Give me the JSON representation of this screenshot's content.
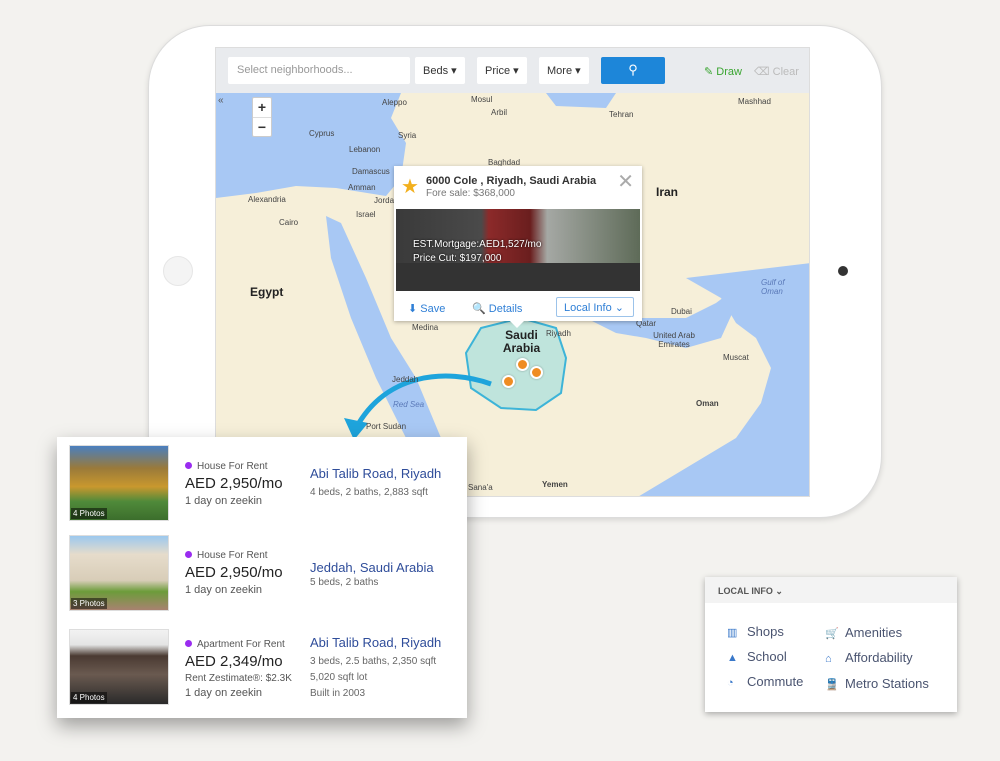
{
  "toolbar": {
    "search_placeholder": "Select neighborhoods...",
    "beds": "Beds ▾",
    "price": "Price ▾",
    "more": "More ▾",
    "search_icon": "search-icon",
    "draw": "Draw",
    "clear": "Clear"
  },
  "map": {
    "zoom_in": "+",
    "zoom_out": "−",
    "collapse": "«",
    "labels": [
      "Aleppo",
      "Mosul",
      "Arbil",
      "Mashhad",
      "Tehran",
      "Cyprus",
      "Syria",
      "Lebanon",
      "Damascus",
      "Baghdad",
      "Amman",
      "Jordan",
      "Israel",
      "Alexandria",
      "Cairo",
      "Egypt",
      "Iran",
      "Medina",
      "Riyadh",
      "Saudi Arabia",
      "Qatar",
      "Dubai",
      "United Arab Emirates",
      "Gulf of Oman",
      "Muscat",
      "Jeddah",
      "Red Sea",
      "Port Sudan",
      "Oman",
      "Sana'a",
      "Yemen"
    ],
    "colors": {
      "land": "#f6efd9",
      "water": "#a8c8f4",
      "area": "#5bc7d6",
      "pin": "#ef8c22"
    }
  },
  "popup": {
    "title": "6000 Cole , Riyadh, Saudi Arabia",
    "subtitle": "Fore sale: $368,000",
    "mortgage": "EST.Mortgage:AED1,527/mo",
    "price_cut": "Price Cut: $197,000",
    "save": "Save",
    "details": "Details",
    "local_info": "Local Info ⌄"
  },
  "listings": [
    {
      "photos": "4 Photos",
      "type": "House For Rent",
      "price": "AED 2,950/mo",
      "days": "1 day on zeekin",
      "address": "Abi Talib Road, Riyadh",
      "details": [
        "4 beds, 2 baths, 2,883 sqft"
      ]
    },
    {
      "photos": "3 Photos",
      "type": "House For Rent",
      "price": "AED 2,950/mo",
      "days": "1 day on zeekin",
      "address": "Jeddah, Saudi Arabia",
      "details": [
        "5 beds, 2 baths"
      ]
    },
    {
      "photos": "4 Photos",
      "type": "Apartment For Rent",
      "price": "AED 2,349/mo",
      "zestimate": "Rent Zestimate®: $2.3K",
      "days": "1 day on zeekin",
      "address": "Abi Talib Road, Riyadh",
      "details": [
        "3 beds, 2.5 baths, 2,350 sqft",
        "5,020 sqft lot",
        "Built in 2003"
      ]
    }
  ],
  "local_info": {
    "title": "LOCAL INFO ⌄",
    "items": [
      {
        "label": "Shops",
        "icon": "shop-icon"
      },
      {
        "label": "School",
        "icon": "graduation-cap-icon"
      },
      {
        "label": "Commute",
        "icon": "clock-icon"
      },
      {
        "label": "Amenities",
        "icon": "cart-icon"
      },
      {
        "label": "Affordability",
        "icon": "home-icon"
      },
      {
        "label": "Metro Stations",
        "icon": "train-icon"
      }
    ]
  }
}
